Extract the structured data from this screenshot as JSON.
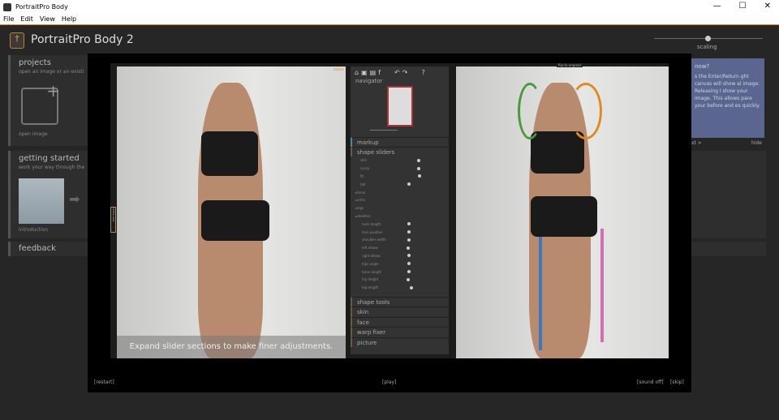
{
  "window": {
    "title": "PortraitPro Body",
    "controls": [
      "—",
      "☐",
      "✕"
    ]
  },
  "menu": [
    "File",
    "Edit",
    "View",
    "Help"
  ],
  "app": {
    "title": "PortraitPro Body 2",
    "scaling_label": "scaling",
    "scaling_value": 0.5
  },
  "sidebar": {
    "projects": {
      "title": "projects",
      "subtitle": "open an image or an existi",
      "open_label": "open image"
    },
    "getting_started": {
      "title": "getting started",
      "subtitle": "work your way through the",
      "item": "introduction"
    },
    "feedback": {
      "title": "feedback"
    }
  },
  "tip": {
    "title": "now?",
    "body": "s the Enter/Return ght canvas will show al image. Releasing l show your image. This allows pare your before and es quickly.",
    "next": "xt >",
    "hide": "hide"
  },
  "editor": {
    "before_label": "before",
    "flip_label": "flip to original",
    "side_tab": "before view",
    "caption": "Expand slider sections to make finer adjustments.",
    "panel": {
      "navigator": "navigator",
      "markup": "markup",
      "shape_sliders": "shape sliders",
      "sliders": [
        {
          "label": "slim",
          "value": 0.7
        },
        {
          "label": "curvy",
          "value": 0.7
        },
        {
          "label": "fit",
          "value": 0.72
        },
        {
          "label": "tall",
          "value": 0.5
        }
      ],
      "groups": [
        "torso",
        "arms",
        "legs",
        "skeleton"
      ],
      "skeleton_sliders": [
        {
          "label": "neck length",
          "value": 0.5
        },
        {
          "label": "face position",
          "value": 0.5
        },
        {
          "label": "shoulder width",
          "value": 0.5
        },
        {
          "label": "left elbow",
          "value": 0.48
        },
        {
          "label": "right elbow",
          "value": 0.5
        },
        {
          "label": "hips angle",
          "value": 0.5
        },
        {
          "label": "torso length",
          "value": 0.5
        },
        {
          "label": "hip height",
          "value": 0.48
        },
        {
          "label": "leg length",
          "value": 0.55
        }
      ],
      "sections": [
        "shape tools",
        "skin",
        "face",
        "warp fixer",
        "picture"
      ]
    }
  },
  "controls": {
    "restart": "[restart]",
    "play": "[play]",
    "sound": "[sound off]",
    "skip": "[skip]"
  },
  "colors": {
    "accent": "#e38a1d",
    "tip_bg": "#5a6590"
  }
}
